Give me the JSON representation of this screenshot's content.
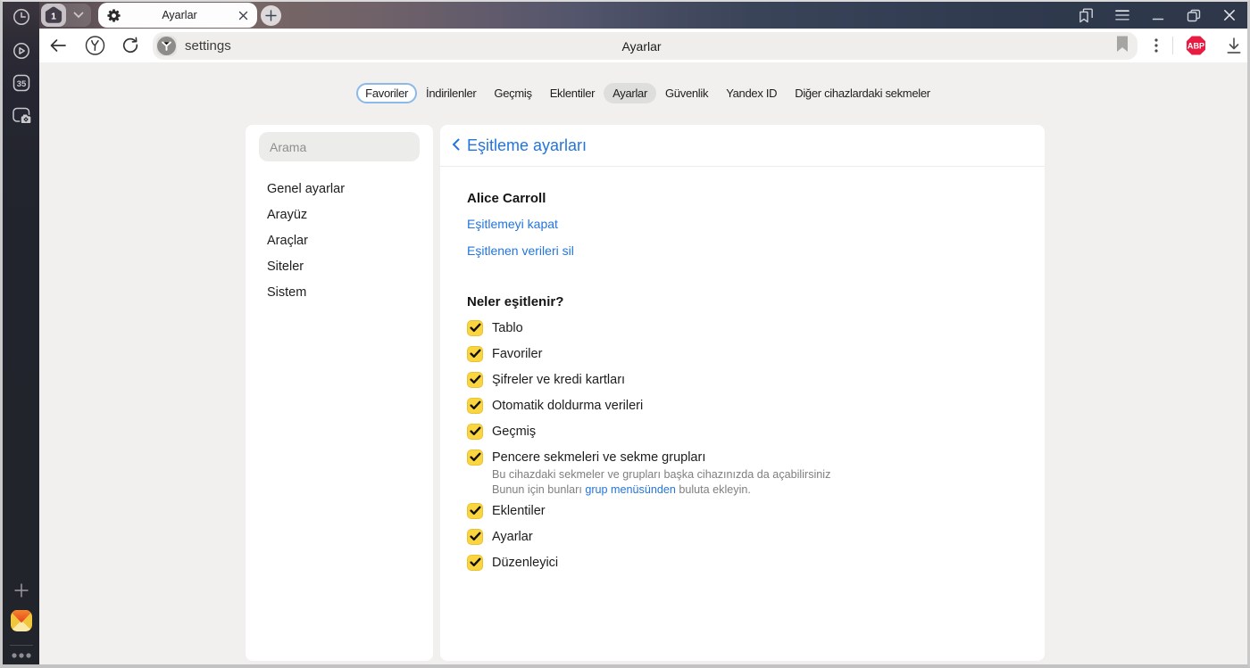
{
  "browser": {
    "sidebar_icons": [
      "history-icon",
      "player-icon",
      "date-badge",
      "screenshot-icon",
      "add-panel-icon",
      "yandex-mail-icon",
      "more-dots-icon"
    ],
    "sidebar_badge": "35",
    "tabstrip": {
      "tab_counter": "1",
      "active_tab_title": "Ayarlar"
    },
    "toolbar": {
      "url_text": "settings",
      "page_title": "Ayarlar",
      "abp_label": "ABP"
    }
  },
  "settings_nav": {
    "items": [
      {
        "label": "Favoriler",
        "style": "outlined"
      },
      {
        "label": "İndirilenler",
        "style": "plain"
      },
      {
        "label": "Geçmiş",
        "style": "plain"
      },
      {
        "label": "Eklentiler",
        "style": "plain"
      },
      {
        "label": "Ayarlar",
        "style": "active"
      },
      {
        "label": "Güvenlik",
        "style": "plain"
      },
      {
        "label": "Yandex ID",
        "style": "plain"
      },
      {
        "label": "Diğer cihazlardaki sekmeler",
        "style": "plain"
      }
    ]
  },
  "settings_sidebar": {
    "search_placeholder": "Arama",
    "items": [
      "Genel ayarlar",
      "Arayüz",
      "Araçlar",
      "Siteler",
      "Sistem"
    ]
  },
  "sync_panel": {
    "title": "Eşitleme ayarları",
    "account_name": "Alice Carroll",
    "links": [
      "Eşitlemeyi kapat",
      "Eşitlenen verileri sil"
    ],
    "section_title": "Neler eşitlenir?",
    "items": [
      {
        "label": "Tablo",
        "checked": true
      },
      {
        "label": "Favoriler",
        "checked": true
      },
      {
        "label": "Şifreler ve kredi kartları",
        "checked": true
      },
      {
        "label": "Otomatik doldurma verileri",
        "checked": true
      },
      {
        "label": "Geçmiş",
        "checked": true
      },
      {
        "label": "Pencere sekmeleri ve sekme grupları",
        "checked": true,
        "desc_line1": "Bu cihazdaki sekmeler ve grupları başka cihazınızda da açabilirsiniz",
        "desc_line2_prefix": "Bunun için bunları ",
        "desc_link": "grup menüsünden",
        "desc_line2_suffix": " buluta ekleyin."
      },
      {
        "label": "Eklentiler",
        "checked": true
      },
      {
        "label": "Ayarlar",
        "checked": true
      },
      {
        "label": "Düzenleyici",
        "checked": true
      }
    ]
  },
  "colors": {
    "accent_blue": "#2375dc",
    "checkbox_yellow": "#f9d43f",
    "abp_red": "#e81c42"
  }
}
